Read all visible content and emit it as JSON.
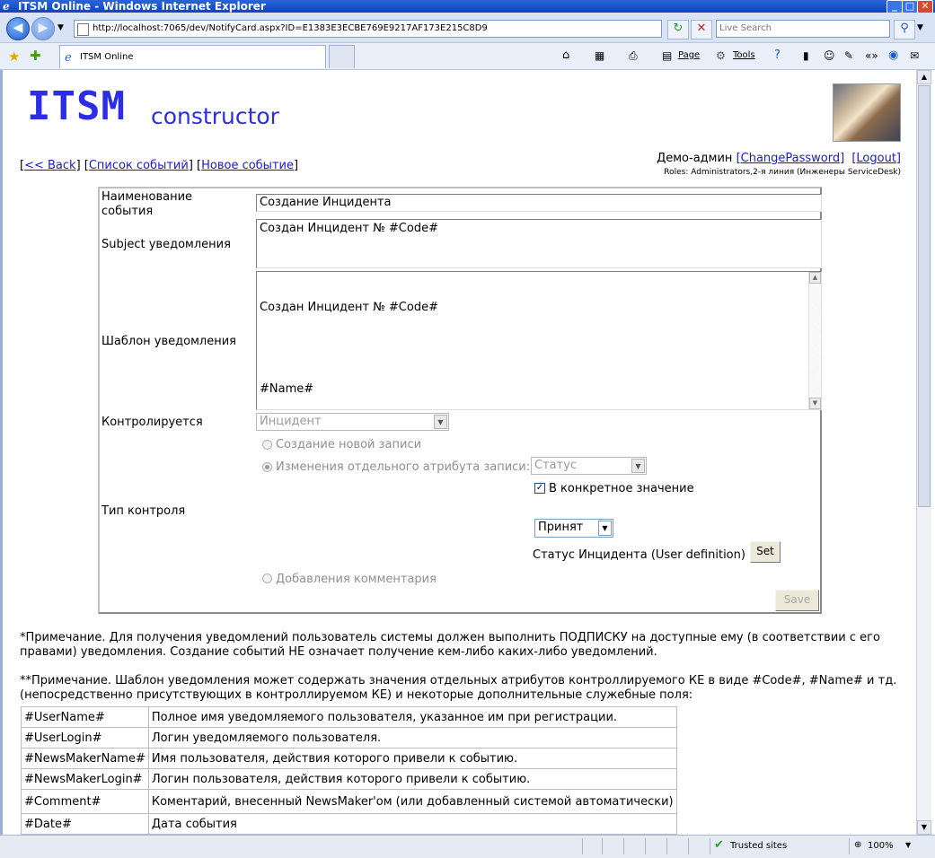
{
  "browser": {
    "window_title": "ITSM Online - Windows Internet Explorer",
    "address": "http://localhost:7065/dev/NotifyCard.aspx?ID=E1383E3ECBE769E9217AF173E215C8D9",
    "search_placeholder": "Live Search",
    "tab_title": "ITSM Online",
    "cmd_page": "Page",
    "cmd_tools": "Tools",
    "status_zone": "Trusted sites",
    "zoom": "100%"
  },
  "header": {
    "logo_big": "ITSM",
    "logo_small": "constructor",
    "back_link": "<< Back",
    "events_list_link": "Список событий",
    "new_event_link": "Новое событие",
    "user_name": "Демо-админ",
    "change_password": "[ChangePassword]",
    "logout": "[Logout]",
    "roles": "Roles: Administrators,2-я линия (Инженеры ServiceDesk)"
  },
  "form": {
    "event_name_label": "Наименование события",
    "event_name_value": "Создание Инцидента",
    "subject_label": "Subject уведомления",
    "subject_value": "Создан Инцидент № #Code#",
    "template_label": "Шаблон уведомления",
    "template_line1": "Создан Инцидент № #Code#",
    "template_line2": "#Name#",
    "controlled_label": "Контролируется",
    "controlled_value": "Инцидент",
    "control_type_label": "Тип контроля",
    "radio_new_record": "Создание новой записи",
    "radio_attr_change": "Изменения отдельного атрибута записи:",
    "attr_value": "Статус",
    "specific_value_label": "В конкретное значение",
    "status_value": "Принят",
    "status_definition": "Статус Инцидента (User definition)",
    "set_button": "Set",
    "radio_comment": "Добавления комментария",
    "save_button": "Save"
  },
  "notes": {
    "note1": "*Примечание. Для получения уведомлений пользователь системы должен выполнить ПОДПИСКУ на доступные ему (в соответствии с его правами) уведомления. Создание событий НЕ означает получение кем-либо каких-либо уведомлений.",
    "note2": "**Примечание. Шаблон уведомления может содержать значения отдельных атрибутов контроллируемого КЕ в виде #Code#, #Name# и тд. (непосредственно присутствующих в контроллируемом КЕ) и некоторые дополнительные служебные поля:"
  },
  "fields_table": [
    {
      "key": "#UserName#",
      "desc": "Полное имя уведомляемого пользователя, указанное им при регистрации."
    },
    {
      "key": "#UserLogin#",
      "desc": "Логин уведомляемого пользователя."
    },
    {
      "key": "#NewsMakerName#",
      "desc": "Имя пользователя, действия которого привели к событию."
    },
    {
      "key": "#NewsMakerLogin#",
      "desc": "Логин пользователя, действия которого привели к событию."
    },
    {
      "key": "#Comment#",
      "desc": "Коментарий, внесенный NewsMaker'ом (или добавленный системой автоматически)"
    },
    {
      "key": "#Date#",
      "desc": "Дата события"
    }
  ]
}
